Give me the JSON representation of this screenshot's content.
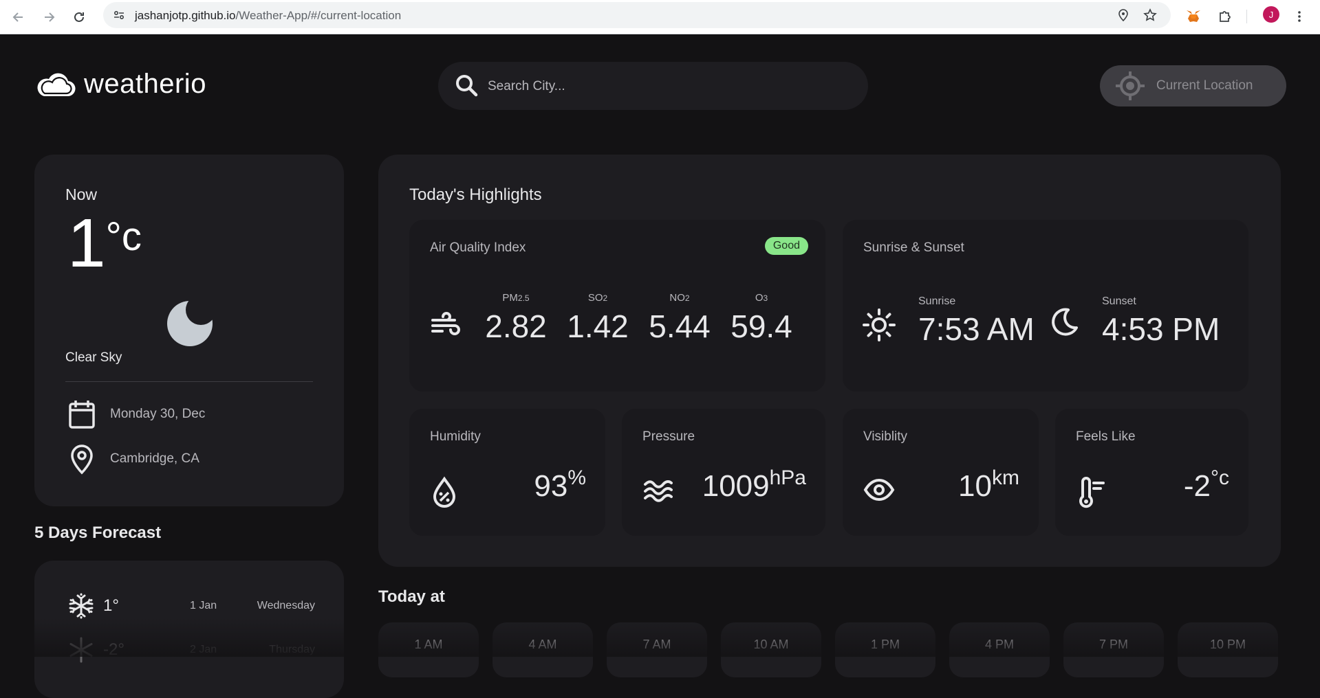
{
  "browser": {
    "url_host": "jashanjotp.github.io",
    "url_path": "/Weather-App/#/current-location",
    "profile_initial": "J"
  },
  "app": {
    "logo_text": "weatherio",
    "search_placeholder": "Search City...",
    "current_location_label": "Current Location"
  },
  "current": {
    "title": "Now",
    "temp": "1",
    "unit": "°c",
    "description": "Clear Sky",
    "date": "Monday 30, Dec",
    "location": "Cambridge, CA"
  },
  "forecast": {
    "title": "5 Days Forecast",
    "days": [
      {
        "temp": "1°",
        "date": "1 Jan",
        "day": "Wednesday",
        "icon": "snowflake-icon"
      },
      {
        "temp": "-2°",
        "date": "2 Jan",
        "day": "Thursday",
        "icon": "snowflake-icon"
      }
    ]
  },
  "highlights": {
    "title": "Today's Highlights",
    "aqi": {
      "label": "Air Quality Index",
      "badge": "Good",
      "items": [
        {
          "key": "PM",
          "sub": "2.5",
          "value": "2.82"
        },
        {
          "key": "SO",
          "sub": "2",
          "value": "1.42"
        },
        {
          "key": "NO",
          "sub": "2",
          "value": "5.44"
        },
        {
          "key": "O",
          "sub": "3",
          "value": "59.4"
        }
      ]
    },
    "sun": {
      "label": "Sunrise & Sunset",
      "sunrise_label": "Sunrise",
      "sunrise": "7:53 AM",
      "sunset_label": "Sunset",
      "sunset": "4:53 PM"
    },
    "humidity": {
      "label": "Humidity",
      "value": "93",
      "unit": "%"
    },
    "pressure": {
      "label": "Pressure",
      "value": "1009",
      "unit": "hPa"
    },
    "visibility": {
      "label": "Visiblity",
      "value": "10",
      "unit": "km"
    },
    "feels_like": {
      "label": "Feels Like",
      "value": "-2",
      "unit": "°c"
    }
  },
  "today": {
    "title": "Today at",
    "hours": [
      "1 AM",
      "4 AM",
      "7 AM",
      "10 AM",
      "1 PM",
      "4 PM",
      "7 PM",
      "10 PM"
    ]
  },
  "colors": {
    "background": "#131214",
    "card": "#1e1d21",
    "badge_good": "#89e589"
  }
}
